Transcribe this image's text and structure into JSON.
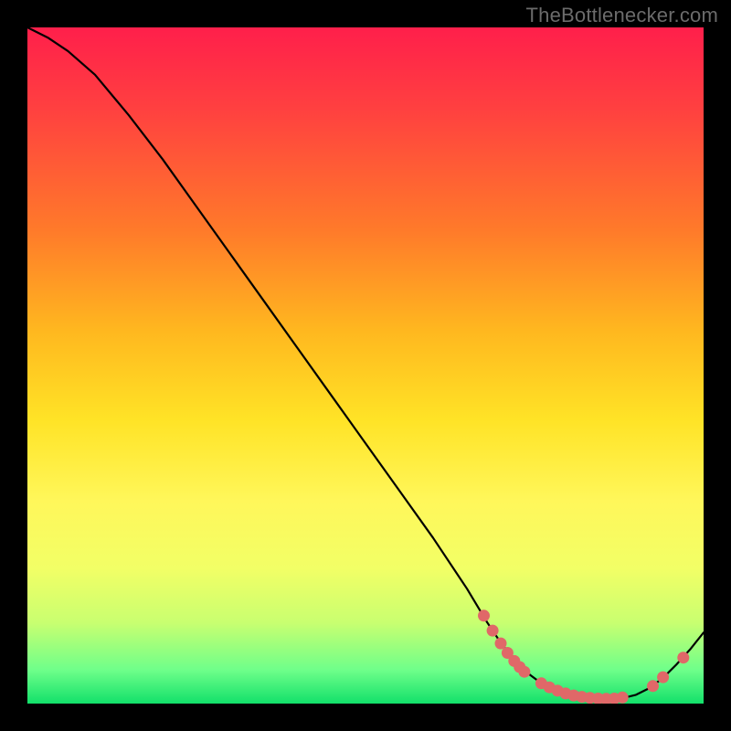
{
  "attribution": "TheBottlenecker.com",
  "colors": {
    "page_bg": "#000000",
    "gradient_stops": [
      "#ff1f4b",
      "#ff4040",
      "#ff7a2a",
      "#ffb81f",
      "#ffe326",
      "#fff75a",
      "#f2ff66",
      "#c9ff70",
      "#6fff8a",
      "#12e06a"
    ],
    "curve": "#000000",
    "beads": "#e06868"
  },
  "chart_data": {
    "type": "line",
    "title": "",
    "xlabel": "",
    "ylabel": "",
    "xlim": [
      0,
      100
    ],
    "ylim": [
      0,
      100
    ],
    "grid": false,
    "legend": false,
    "series": [
      {
        "name": "curve",
        "x": [
          0,
          3,
          6,
          10,
          15,
          20,
          25,
          30,
          35,
          40,
          45,
          50,
          55,
          60,
          65,
          68,
          70,
          72,
          74,
          76,
          78,
          80,
          82,
          84,
          86,
          88,
          90,
          92,
          94,
          96,
          98,
          100
        ],
        "y": [
          100,
          98.5,
          96.5,
          93,
          87,
          80.5,
          73.5,
          66.5,
          59.5,
          52.5,
          45.5,
          38.5,
          31.5,
          24.5,
          17,
          12,
          9,
          6.5,
          4.5,
          3,
          2,
          1.3,
          0.9,
          0.7,
          0.6,
          0.8,
          1.3,
          2.3,
          3.8,
          5.8,
          8,
          10.5
        ]
      }
    ],
    "marker_clusters": [
      {
        "name": "left-dense-cluster",
        "x": [
          67.5,
          68.8,
          70.0,
          71.0,
          72.0,
          72.8,
          73.5
        ],
        "y": [
          13.0,
          10.8,
          8.9,
          7.5,
          6.3,
          5.4,
          4.7
        ]
      },
      {
        "name": "valley-floor-cluster",
        "x": [
          76.0,
          77.2,
          78.4,
          79.6,
          80.8,
          82.0,
          83.2,
          84.4,
          85.6,
          86.8,
          88.0
        ],
        "y": [
          3.0,
          2.4,
          1.9,
          1.5,
          1.2,
          1.0,
          0.85,
          0.75,
          0.7,
          0.75,
          0.9
        ]
      },
      {
        "name": "right-pair-cluster",
        "x": [
          92.5,
          94.0
        ],
        "y": [
          2.6,
          3.9
        ]
      },
      {
        "name": "rising-single",
        "x": [
          97.0
        ],
        "y": [
          6.8
        ]
      }
    ]
  }
}
